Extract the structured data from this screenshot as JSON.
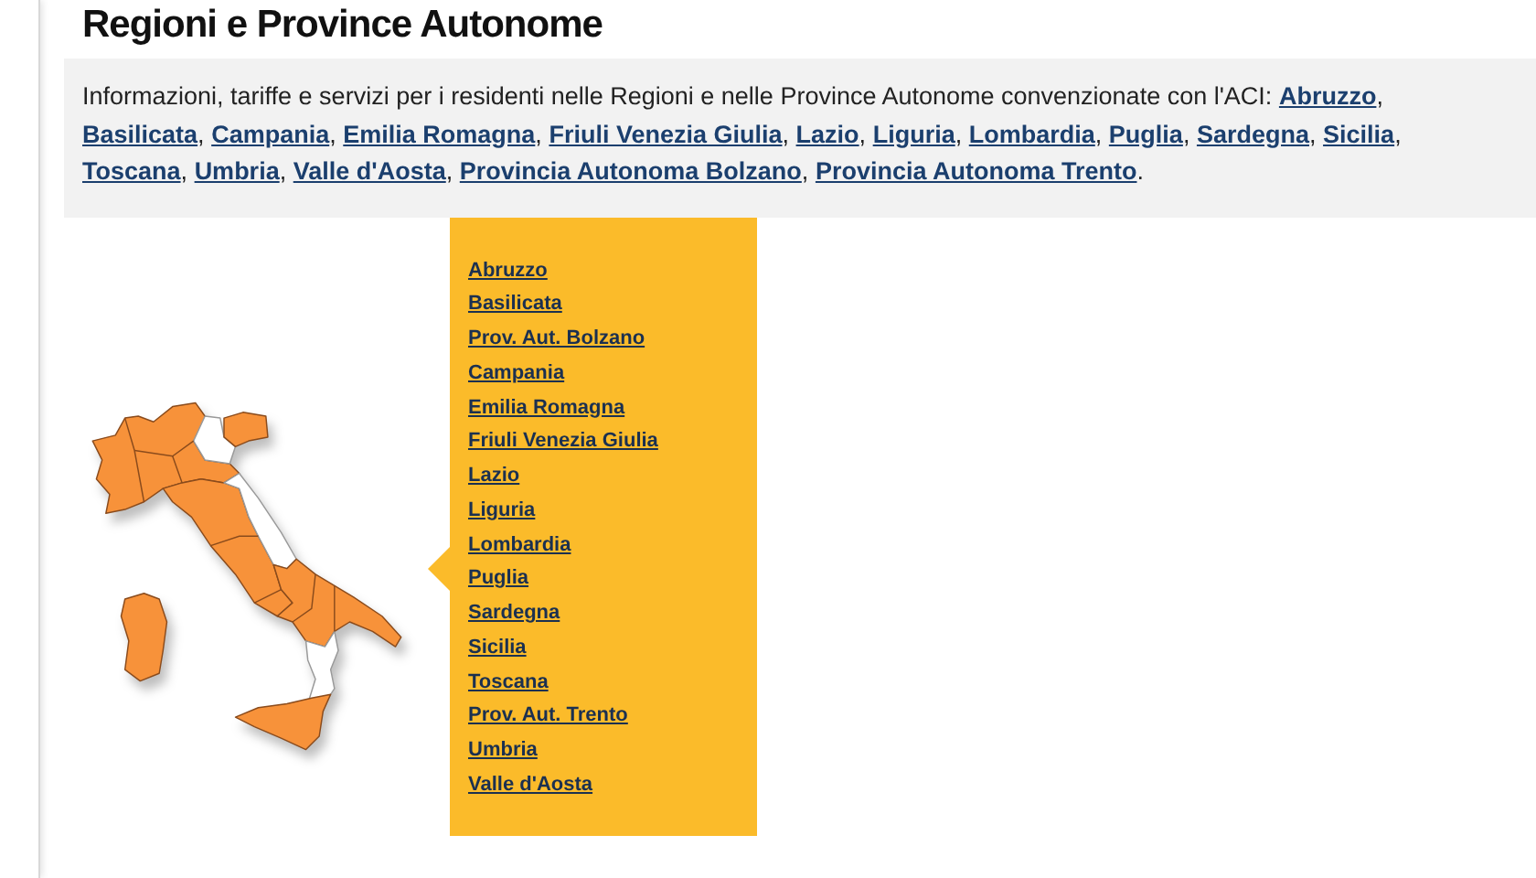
{
  "title": "Regioni e Province Autonome",
  "intro": {
    "text": "Informazioni, tariffe e servizi per i residenti nelle Regioni e nelle Province Autonome convenzionate con l'ACI:",
    "links": [
      {
        "label": "Abruzzo",
        "suffix": ","
      },
      {
        "label": "Basilicata",
        "suffix": ","
      },
      {
        "label": "Campania",
        "suffix": ","
      },
      {
        "label": "Emilia Romagna",
        "suffix": ","
      },
      {
        "label": "Friuli Venezia Giulia",
        "suffix": ","
      },
      {
        "label": "Lazio",
        "suffix": ","
      },
      {
        "label": "Liguria",
        "suffix": ","
      },
      {
        "label": "Lombardia",
        "suffix": ","
      },
      {
        "label": "Puglia",
        "suffix": ","
      },
      {
        "label": "Sardegna",
        "suffix": ","
      },
      {
        "label": "Sicilia",
        "suffix": ","
      },
      {
        "label": "Toscana",
        "suffix": ","
      },
      {
        "label": "Umbria",
        "suffix": ","
      },
      {
        "label": "Valle d'Aosta",
        "suffix": ","
      },
      {
        "label": "Provincia Autonoma Bolzano",
        "suffix": ","
      },
      {
        "label": "Provincia Autonoma Trento",
        "suffix": "."
      }
    ]
  },
  "region_menu": [
    "Abruzzo",
    "Basilicata",
    "Prov. Aut. Bolzano",
    "Campania",
    "Emilia Romagna",
    "Friuli Venezia Giulia",
    "Lazio",
    "Liguria",
    "Lombardia",
    "Puglia",
    "Sardegna",
    "Sicilia",
    "Toscana",
    "Prov. Aut. Trento",
    "Umbria",
    "Valle d'Aosta"
  ]
}
